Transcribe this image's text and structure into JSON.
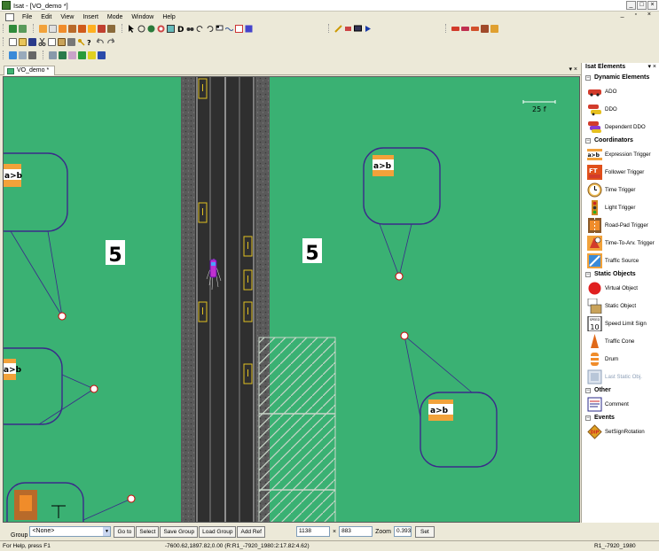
{
  "window": {
    "title": "Isat - [VO_demo *]"
  },
  "menu": [
    "File",
    "Edit",
    "View",
    "Insert",
    "Mode",
    "Window",
    "Help"
  ],
  "tab": {
    "label": "VO_demo *"
  },
  "canvas": {
    "scale_label": "25 f",
    "speed_labels": [
      "5",
      "5"
    ],
    "trigger_icon_label": "a>b"
  },
  "panel": {
    "title": "Isat Elements",
    "categories": [
      {
        "name": "Dynamic Elements",
        "items": [
          {
            "label": "ADO",
            "icon": "red-car-icon"
          },
          {
            "label": "DDO",
            "icon": "ddo-cars-icon"
          },
          {
            "label": "Dependent DDO",
            "icon": "dependent-ddo-icon"
          }
        ]
      },
      {
        "name": "Coordinators",
        "items": [
          {
            "label": "Expression Trigger",
            "icon": "expression-trigger-icon"
          },
          {
            "label": "Follower Trigger",
            "icon": "follower-trigger-icon"
          },
          {
            "label": "Time Trigger",
            "icon": "clock-icon"
          },
          {
            "label": "Light Trigger",
            "icon": "traffic-light-icon"
          },
          {
            "label": "Road-Pad Trigger",
            "icon": "road-pad-icon"
          },
          {
            "label": "Time-To-Arv. Trigger",
            "icon": "time-to-arrival-icon"
          },
          {
            "label": "Traffic Source",
            "icon": "traffic-source-icon"
          }
        ]
      },
      {
        "name": "Static Objects",
        "items": [
          {
            "label": "Virtual Object",
            "icon": "red-circle-icon"
          },
          {
            "label": "Static Object",
            "icon": "static-object-icon"
          },
          {
            "label": "Speed Limit Sign",
            "icon": "speed-limit-sign-icon"
          },
          {
            "label": "Traffic Cone",
            "icon": "traffic-cone-icon"
          },
          {
            "label": "Drum",
            "icon": "drum-icon"
          },
          {
            "label": "Last Static Obj.",
            "icon": "last-static-object-icon",
            "disabled": true
          }
        ]
      },
      {
        "name": "Other",
        "items": [
          {
            "label": "Comment",
            "icon": "comment-icon"
          }
        ]
      },
      {
        "name": "Events",
        "items": [
          {
            "label": "SetSignRotation",
            "icon": "set-sign-rotation-icon"
          }
        ]
      }
    ]
  },
  "bottom": {
    "group_label": "Group",
    "group_value": "<None>",
    "buttons": [
      "Go to",
      "Select",
      "Save Group",
      "Load Group",
      "Add Ref"
    ],
    "coord_x": "1138",
    "times": "×",
    "coord_y": "883",
    "zoom_label": "Zoom",
    "zoom_value": "0.393",
    "set_label": "Set"
  },
  "status": {
    "help": "For Help, press F1",
    "coords": "-7600.62,1897.82,0.00 (R:R1_-7920_1980:2:17.82:4.62)",
    "road": "R1_-7920_1980"
  }
}
